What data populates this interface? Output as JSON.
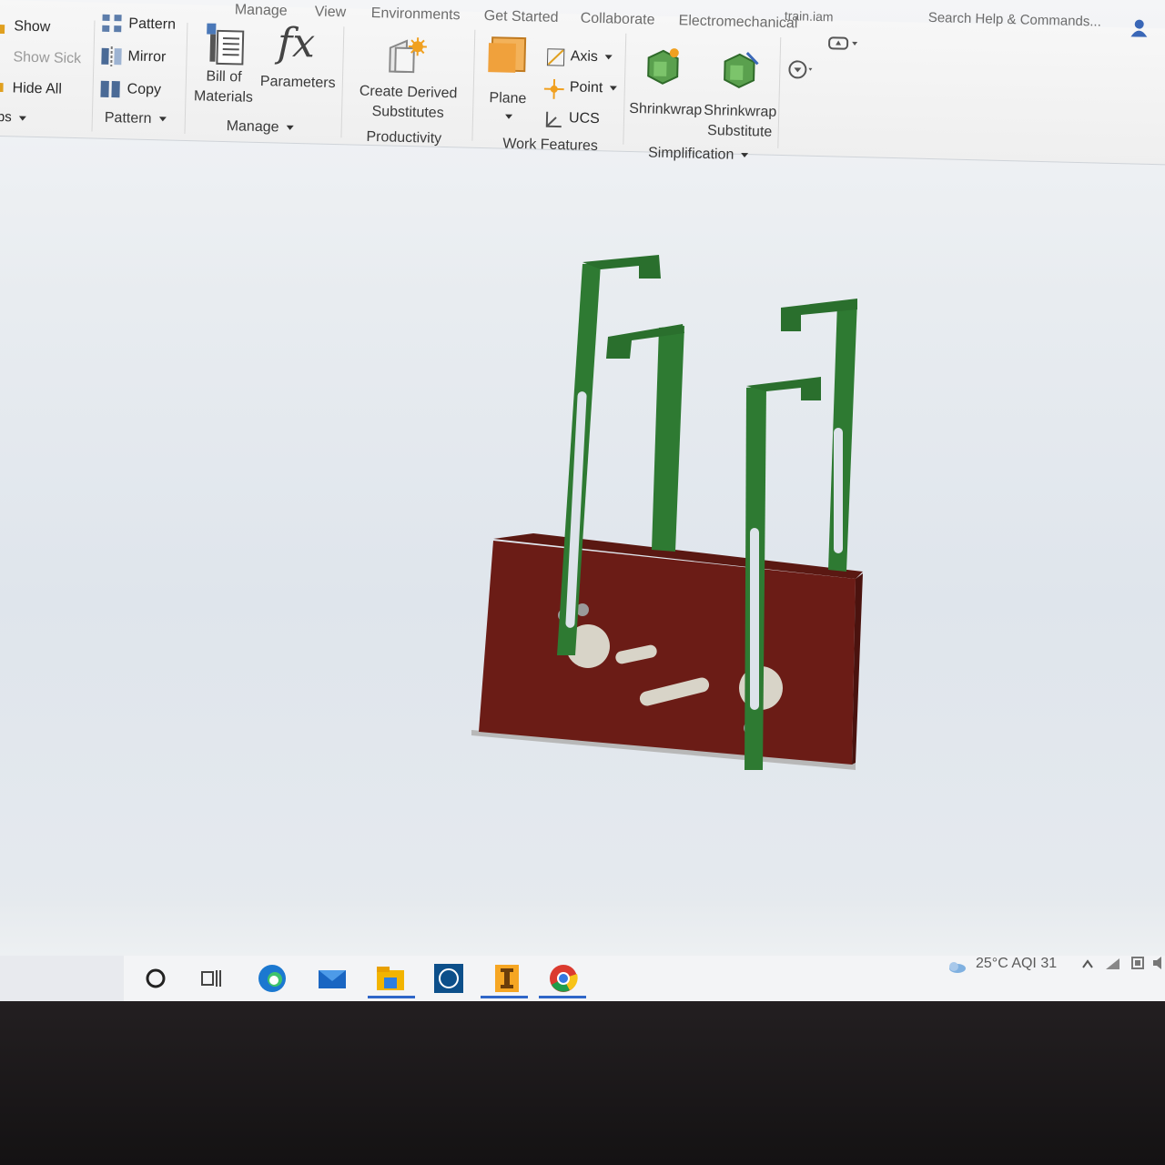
{
  "tabs": {
    "manage": "Manage",
    "view": "View",
    "environments": "Environments",
    "get_started": "Get Started",
    "collaborate": "Collaborate",
    "electromechanical": "Electromechanical",
    "file_title": "train.iam",
    "search_placeholder": "Search Help & Commands..."
  },
  "ribbon": {
    "visibility": {
      "show": "Show",
      "show_sick": "Show Sick",
      "hide_all": "Hide All",
      "dropdown": "ps"
    },
    "pattern_panel": {
      "pattern": "Pattern",
      "mirror": "Mirror",
      "copy": "Copy",
      "panel_title": "Pattern"
    },
    "manage_panel": {
      "bom_line1": "Bill of",
      "bom_line2": "Materials",
      "parameters": "Parameters",
      "fx_glyph": "fx",
      "panel_title": "Manage"
    },
    "productivity_panel": {
      "create_line1": "Create Derived",
      "create_line2": "Substitutes",
      "panel_title": "Productivity"
    },
    "work_features_panel": {
      "plane": "Plane",
      "axis": "Axis",
      "point": "Point",
      "ucs": "UCS",
      "panel_title": "Work Features"
    },
    "simplification_panel": {
      "shrinkwrap": "Shrinkwrap",
      "shrinkwrap_sub_line1": "Shrinkwrap",
      "shrinkwrap_sub_line2": "Substitute",
      "panel_title": "Simplification"
    }
  },
  "model": {
    "base_color": "#6b1c16",
    "bracket_color": "#2e7a32",
    "hole_color": "#d8d4c8"
  },
  "taskbar": {
    "icons": [
      "search-circle-icon",
      "task-view-icon",
      "edge-icon",
      "mail-icon",
      "file-explorer-icon",
      "dell-icon",
      "inventor-icon",
      "chrome-icon"
    ],
    "weather": "25°C  AQI 31"
  }
}
